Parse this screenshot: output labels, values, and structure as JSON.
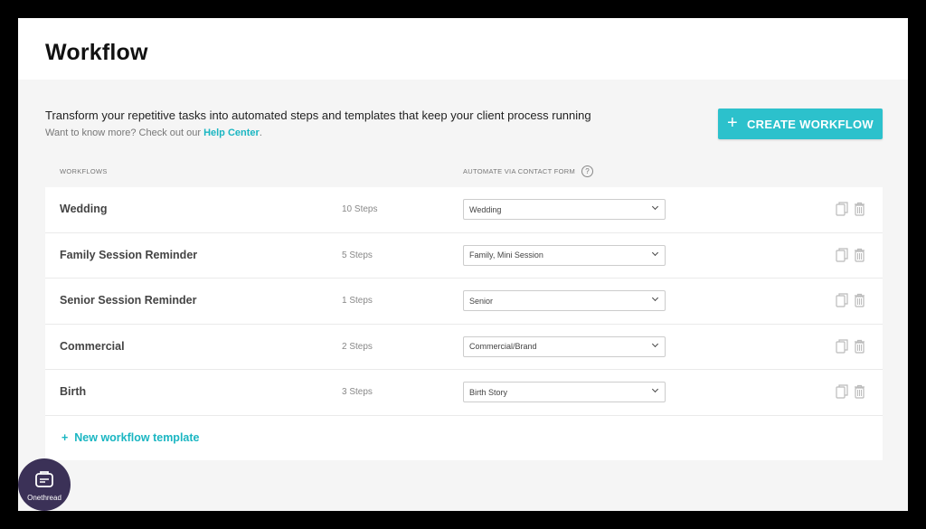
{
  "header": {
    "title": "Workflow"
  },
  "intro": {
    "text": "Transform your repetitive tasks into automated steps and templates that keep your client process running",
    "sub_prefix": "Want to know more? Check out our ",
    "help_link": "Help Center",
    "sub_suffix": "."
  },
  "create_button": {
    "label": "CREATE WORKFLOW",
    "icon": "plus-icon"
  },
  "columns": {
    "workflows": "WORKFLOWS",
    "automate": "AUTOMATE VIA CONTACT FORM",
    "help": "?"
  },
  "workflows": [
    {
      "name": "Wedding",
      "steps": "10 Steps",
      "form": "Wedding"
    },
    {
      "name": "Family Session Reminder",
      "steps": "5 Steps",
      "form": "Family, Mini Session"
    },
    {
      "name": "Senior Session Reminder",
      "steps": "1 Steps",
      "form": "Senior"
    },
    {
      "name": "Commercial",
      "steps": "2 Steps",
      "form": "Commercial/Brand"
    },
    {
      "name": "Birth",
      "steps": "3 Steps",
      "form": "Birth Story"
    }
  ],
  "new_template": {
    "label": "New workflow template",
    "plus": "+"
  },
  "logo": {
    "text": "Onethread"
  },
  "colors": {
    "accent": "#2cc1cc",
    "link": "#1ab6c2",
    "logo_bg": "#3b3157"
  }
}
